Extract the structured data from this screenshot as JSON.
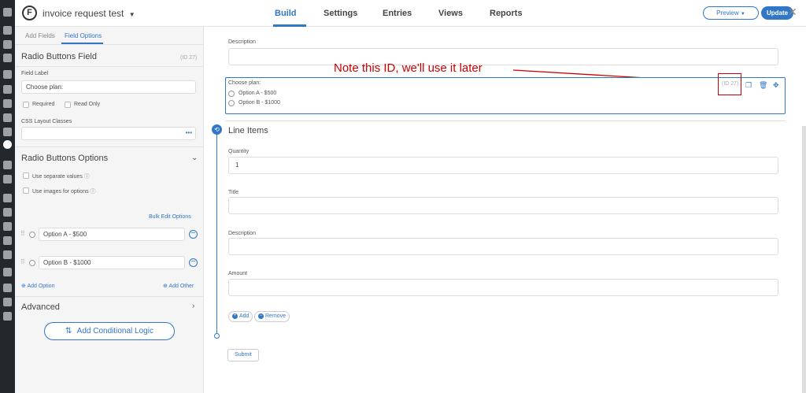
{
  "app": {
    "logo_letter": "F",
    "form_name": "invoice request test",
    "nav": [
      "Build",
      "Settings",
      "Entries",
      "Views",
      "Reports"
    ],
    "preview_label": "Preview",
    "update_label": "Update",
    "close": "✕",
    "accent": "#3177c7",
    "annotation_color": "#cc0000"
  },
  "sidebar": {
    "tabs": [
      "Add Fields",
      "Field Options"
    ],
    "field_type": "Radio Buttons Field",
    "field_id": "(ID 27)",
    "field_label_title": "Field Label",
    "field_label_value": "Choose plan:",
    "required_label": "Required",
    "read_only_label": "Read Only",
    "css_classes_title": "CSS Layout Classes",
    "css_more": "•••",
    "options_title": "Radio Buttons Options",
    "separate_values_label": "Use separate values",
    "images_label": "Use images for options",
    "bulk_edit": "Bulk Edit Options",
    "options": [
      "Option A - $500",
      "Option B - $1000"
    ],
    "add_option": "Add Option",
    "add_other": "Add Other",
    "advanced_title": "Advanced",
    "conditional_logic": "Add Conditional Logic"
  },
  "canvas": {
    "description_label": "Description",
    "selected_field": {
      "label": "Choose plan:",
      "options": [
        "Option A - $500",
        "Option B - $1000"
      ],
      "id": "(ID 27)"
    },
    "annotation": "Note this ID, we'll use it later",
    "section_title": "Line Items",
    "quantity_label": "Quantity",
    "quantity_value": "1",
    "title_label": "Title",
    "line_description_label": "Description",
    "amount_label": "Amount",
    "add_label": "Add",
    "remove_label": "Remove",
    "submit_label": "Submit"
  }
}
